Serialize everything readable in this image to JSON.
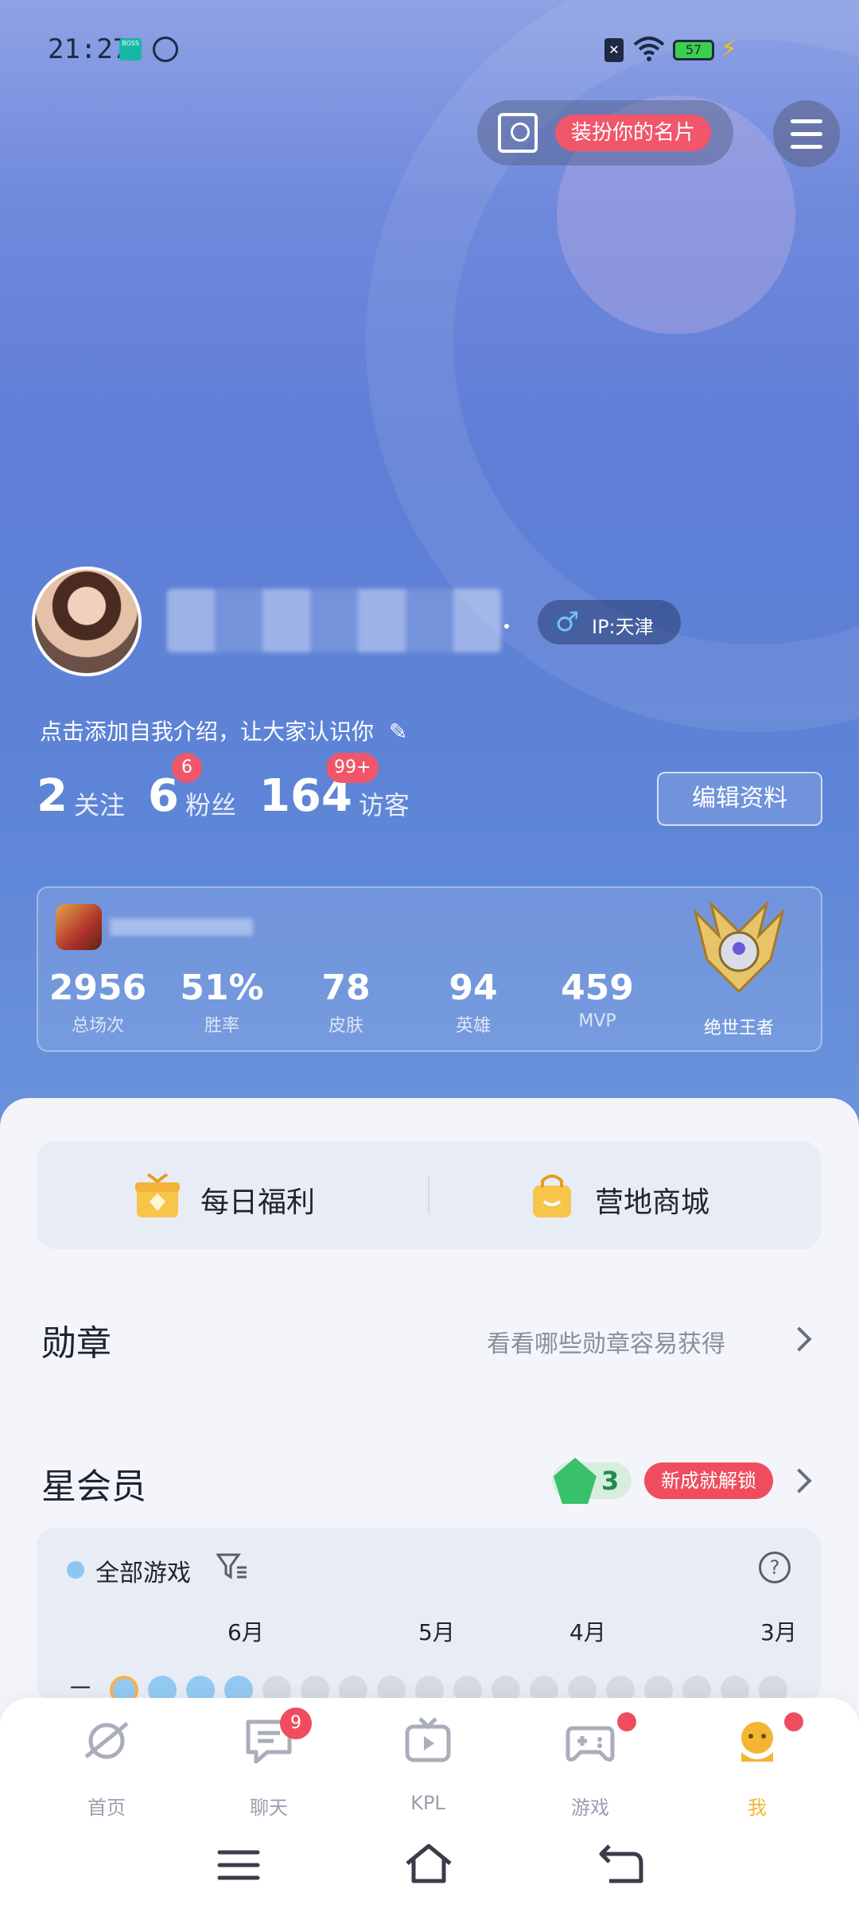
{
  "status_bar": {
    "time": "21:27",
    "boss_label": "BOSS",
    "battery": "57"
  },
  "header": {
    "card_pill_label": "装扮你的名片"
  },
  "profile": {
    "ip_label": "IP:天津",
    "bio": "点击添加自我介绍，让大家认识你",
    "stats": [
      {
        "value": "2",
        "label": "关注",
        "badge": ""
      },
      {
        "value": "6",
        "label": "粉丝",
        "badge": "6"
      },
      {
        "value": "164",
        "label": "访客",
        "badge": "99+"
      }
    ],
    "edit_button": "编辑资料"
  },
  "game_card": {
    "stats": [
      {
        "value": "2956",
        "label": "总场次"
      },
      {
        "value": "51%",
        "label": "胜率"
      },
      {
        "value": "78",
        "label": "皮肤"
      },
      {
        "value": "94",
        "label": "英雄"
      },
      {
        "value": "459",
        "label": "MVP"
      }
    ],
    "rank": "绝世王者"
  },
  "quick_actions": [
    {
      "label": "每日福利",
      "icon": "gift-icon"
    },
    {
      "label": "营地商城",
      "icon": "shopping-bag-icon"
    }
  ],
  "badges_section": {
    "title": "勋章",
    "link": "看看哪些勋章容易获得"
  },
  "star_member": {
    "title": "星会员",
    "level": "3",
    "unlock_label": "新成就解锁"
  },
  "calendar": {
    "filter_label": "全部游戏",
    "months": [
      "6月",
      "5月",
      "4月",
      "3月"
    ],
    "row_label": "一",
    "days_total": 18,
    "active_days": 4
  },
  "tabbar": [
    {
      "label": "首页",
      "icon": "home-planet-icon",
      "badge": ""
    },
    {
      "label": "聊天",
      "icon": "chat-icon",
      "badge": "9"
    },
    {
      "label": "KPL",
      "icon": "tv-play-icon",
      "badge": ""
    },
    {
      "label": "游戏",
      "icon": "gamepad-icon",
      "badge": "dot"
    },
    {
      "label": "我",
      "icon": "me-icon",
      "badge": "dot"
    }
  ],
  "colors": {
    "accent_red": "#ef4d5f",
    "active_tab": "#f0b73a",
    "hero_blue": "#5f7ed6"
  }
}
